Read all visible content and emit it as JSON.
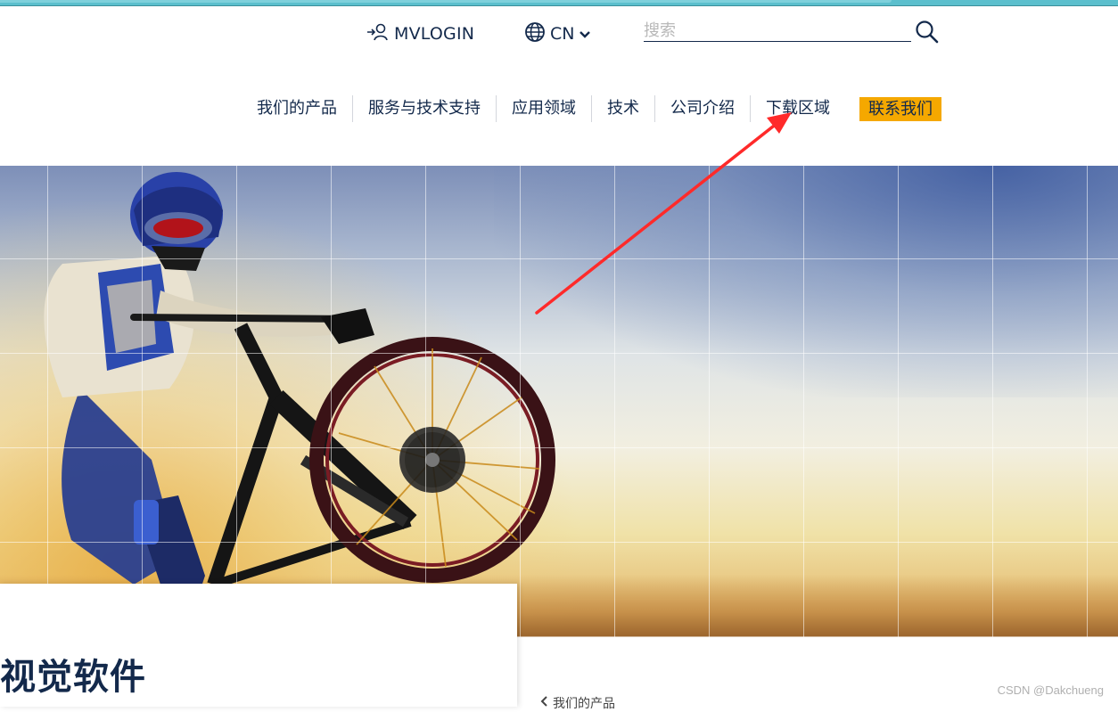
{
  "header": {
    "login_label": "MVLOGIN",
    "language_label": "CN",
    "search": {
      "placeholder": "搜索",
      "value": ""
    }
  },
  "nav": {
    "items": [
      {
        "label": "我们的产品"
      },
      {
        "label": "服务与技术支持"
      },
      {
        "label": "应用领域"
      },
      {
        "label": "技术"
      },
      {
        "label": "公司介绍"
      },
      {
        "label": "下载区域"
      }
    ],
    "cta_label": "联系我们"
  },
  "hero": {
    "image_icon": "mountain-bike-rider-image"
  },
  "content": {
    "title": "视觉软件",
    "breadcrumb_back": "我们的产品"
  },
  "watermark": "CSDN @Dakchueng",
  "annotation": {
    "color": "#ff2a2a",
    "target": "下载区域"
  },
  "colors": {
    "brand_navy": "#13294b",
    "accent_yellow": "#f5a800"
  }
}
